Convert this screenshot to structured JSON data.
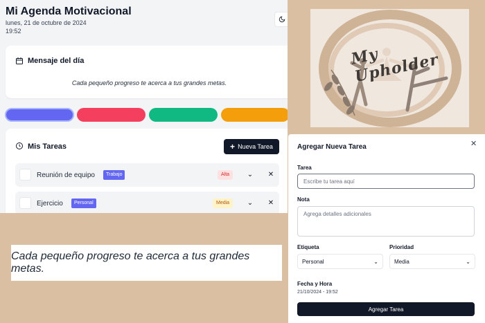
{
  "header": {
    "title": "Mi Agenda Motivacional",
    "date": "lunes, 21 de octubre de 2024",
    "time": "19:52",
    "theme_icon": "moon-icon"
  },
  "message_card": {
    "title": "Mensaje del día",
    "icon": "calendar-icon",
    "text": "Cada pequeño progreso te acerca a tus grandes metas."
  },
  "color_pills": {
    "colors": [
      "#6366f1",
      "#f43f5e",
      "#10b981",
      "#f59e0b"
    ],
    "selected_index": 0
  },
  "tasks": {
    "title": "Mis Tareas",
    "icon": "clock-icon",
    "new_button_label": "Nueva Tarea",
    "items": [
      {
        "name": "Reunión de equipo",
        "tag": "Trabajo",
        "priority": "Alta"
      },
      {
        "name": "Ejercicio",
        "tag": "Personal",
        "priority": "Media"
      }
    ]
  },
  "zoom_quote": {
    "text": "Cada pequeño progreso te acerca a tus grandes metas."
  },
  "logo": {
    "text": "My Upholder"
  },
  "modal": {
    "title": "Agregar Nueva Tarea",
    "task_label": "Tarea",
    "task_placeholder": "Escribe tu tarea aquí",
    "note_label": "Nota",
    "note_placeholder": "Agrega detalles adicionales",
    "tag_label": "Etiqueta",
    "tag_value": "Personal",
    "priority_label": "Prioridad",
    "priority_value": "Media",
    "datetime_label": "Fecha y Hora",
    "datetime_value": "21/10/2024 - 19:52",
    "submit_label": "Agregar Tarea"
  },
  "colors": {
    "background": "#dbbfa3",
    "accent_dark": "#111827",
    "tag_purple": "#6366f1"
  }
}
